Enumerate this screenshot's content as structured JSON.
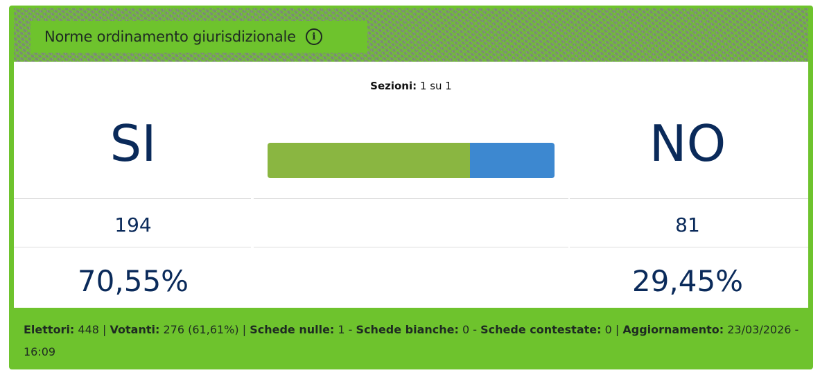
{
  "header": {
    "title": "Norme ordinamento giurisdizionale",
    "info_icon": "info-icon"
  },
  "sezioni": {
    "label": "Sezioni:",
    "value": "1 su 1"
  },
  "results": {
    "si": {
      "label": "SI",
      "count": "194",
      "percent": "70,55%",
      "color": "#8ab641",
      "fraction": 0.7055
    },
    "no": {
      "label": "NO",
      "count": "81",
      "percent": "29,45%",
      "color": "#3d88d0",
      "fraction": 0.2945
    }
  },
  "footer": {
    "elettori_label": "Elettori:",
    "elettori_value": "448",
    "votanti_label": "Votanti:",
    "votanti_value": "276 (61,61%)",
    "nulle_label": "Schede nulle:",
    "nulle_value": "1",
    "bianche_label": "Schede bianche:",
    "bianche_value": "0",
    "contestate_label": "Schede contestate:",
    "contestate_value": "0",
    "aggiornamento_label": "Aggiornamento:",
    "aggiornamento_value": "23/03/2026 - 16:09"
  },
  "colors": {
    "card_green": "#6ec32d",
    "text_navy": "#0a2a5a"
  }
}
